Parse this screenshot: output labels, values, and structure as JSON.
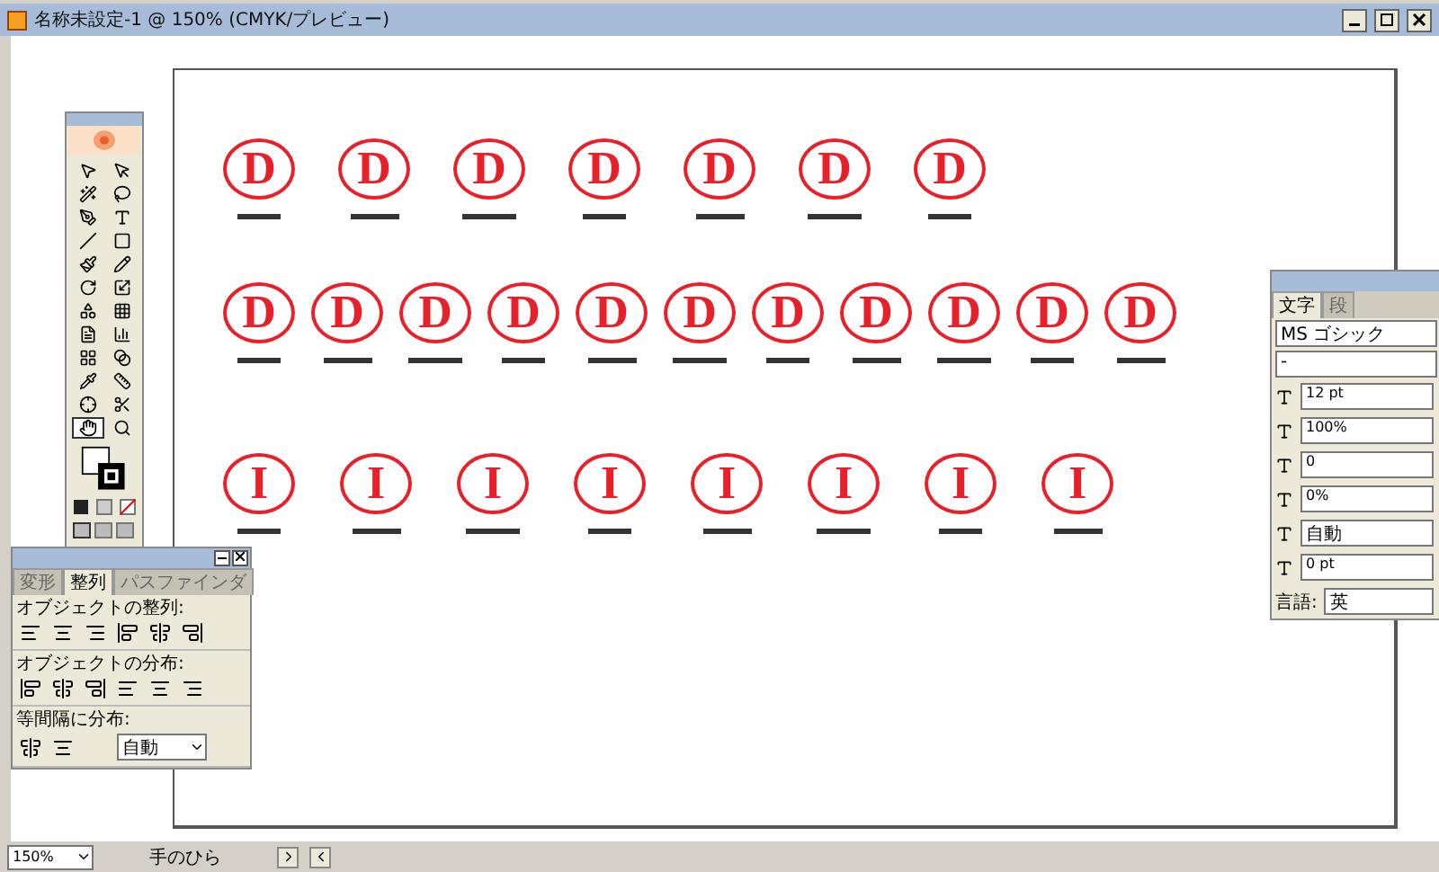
{
  "window": {
    "title": "名称未設定-1 @ 150% (CMYK/プレビュー)"
  },
  "toolbox": {
    "tools": [
      {
        "selected": false
      },
      {
        "selected": false
      },
      {
        "selected": false
      },
      {
        "selected": false
      },
      {
        "selected": false
      },
      {
        "selected": false
      },
      {
        "selected": false
      },
      {
        "selected": false
      },
      {
        "selected": false
      },
      {
        "selected": false
      },
      {
        "selected": false
      },
      {
        "selected": false
      },
      {
        "selected": false
      },
      {
        "selected": false
      },
      {
        "selected": false
      },
      {
        "selected": false
      },
      {
        "selected": false
      },
      {
        "selected": false
      },
      {
        "selected": false
      },
      {
        "selected": false
      },
      {
        "selected": false
      },
      {
        "selected": false
      },
      {
        "selected": true
      },
      {
        "selected": false
      }
    ]
  },
  "stamp_rows": [
    {
      "stamps": [
        {
          "letter": "D"
        },
        {
          "letter": "D"
        },
        {
          "letter": "D"
        },
        {
          "letter": "D"
        },
        {
          "letter": "D"
        },
        {
          "letter": "D"
        },
        {
          "letter": "D"
        }
      ]
    },
    {
      "stamps": [
        {
          "letter": "D"
        },
        {
          "letter": "D"
        },
        {
          "letter": "D"
        },
        {
          "letter": "D"
        },
        {
          "letter": "D"
        },
        {
          "letter": "D"
        },
        {
          "letter": "D"
        },
        {
          "letter": "D"
        },
        {
          "letter": "D"
        },
        {
          "letter": "D"
        },
        {
          "letter": "D"
        }
      ]
    },
    {
      "stamps": [
        {
          "letter": "I"
        },
        {
          "letter": "I"
        },
        {
          "letter": "I"
        },
        {
          "letter": "I"
        },
        {
          "letter": "I"
        },
        {
          "letter": "I"
        },
        {
          "letter": "I"
        },
        {
          "letter": "I"
        }
      ]
    }
  ],
  "align_panel": {
    "tabs": [
      {
        "label": "変形",
        "selected": false
      },
      {
        "label": "整列",
        "selected": true
      },
      {
        "label": "パスファインダ",
        "selected": false
      }
    ],
    "sections": [
      {
        "title": "オブジェクトの整列:"
      },
      {
        "title": "オブジェクトの分布:"
      },
      {
        "title": "等間隔に分布:"
      }
    ],
    "spacing": "自動"
  },
  "character_panel": {
    "tabs": [
      {
        "label": "文字",
        "selected": true
      },
      {
        "label": "段",
        "selected": false
      }
    ],
    "font": "MS ゴシック",
    "style": "-",
    "size": "12 pt",
    "scale": "100%",
    "kerning": "0",
    "tracking": "0%",
    "leading": "自動",
    "baseline": "0 pt",
    "language_label": "言語:",
    "language": "英"
  },
  "status_bar": {
    "zoom": "150%",
    "tool": "手のひら"
  }
}
